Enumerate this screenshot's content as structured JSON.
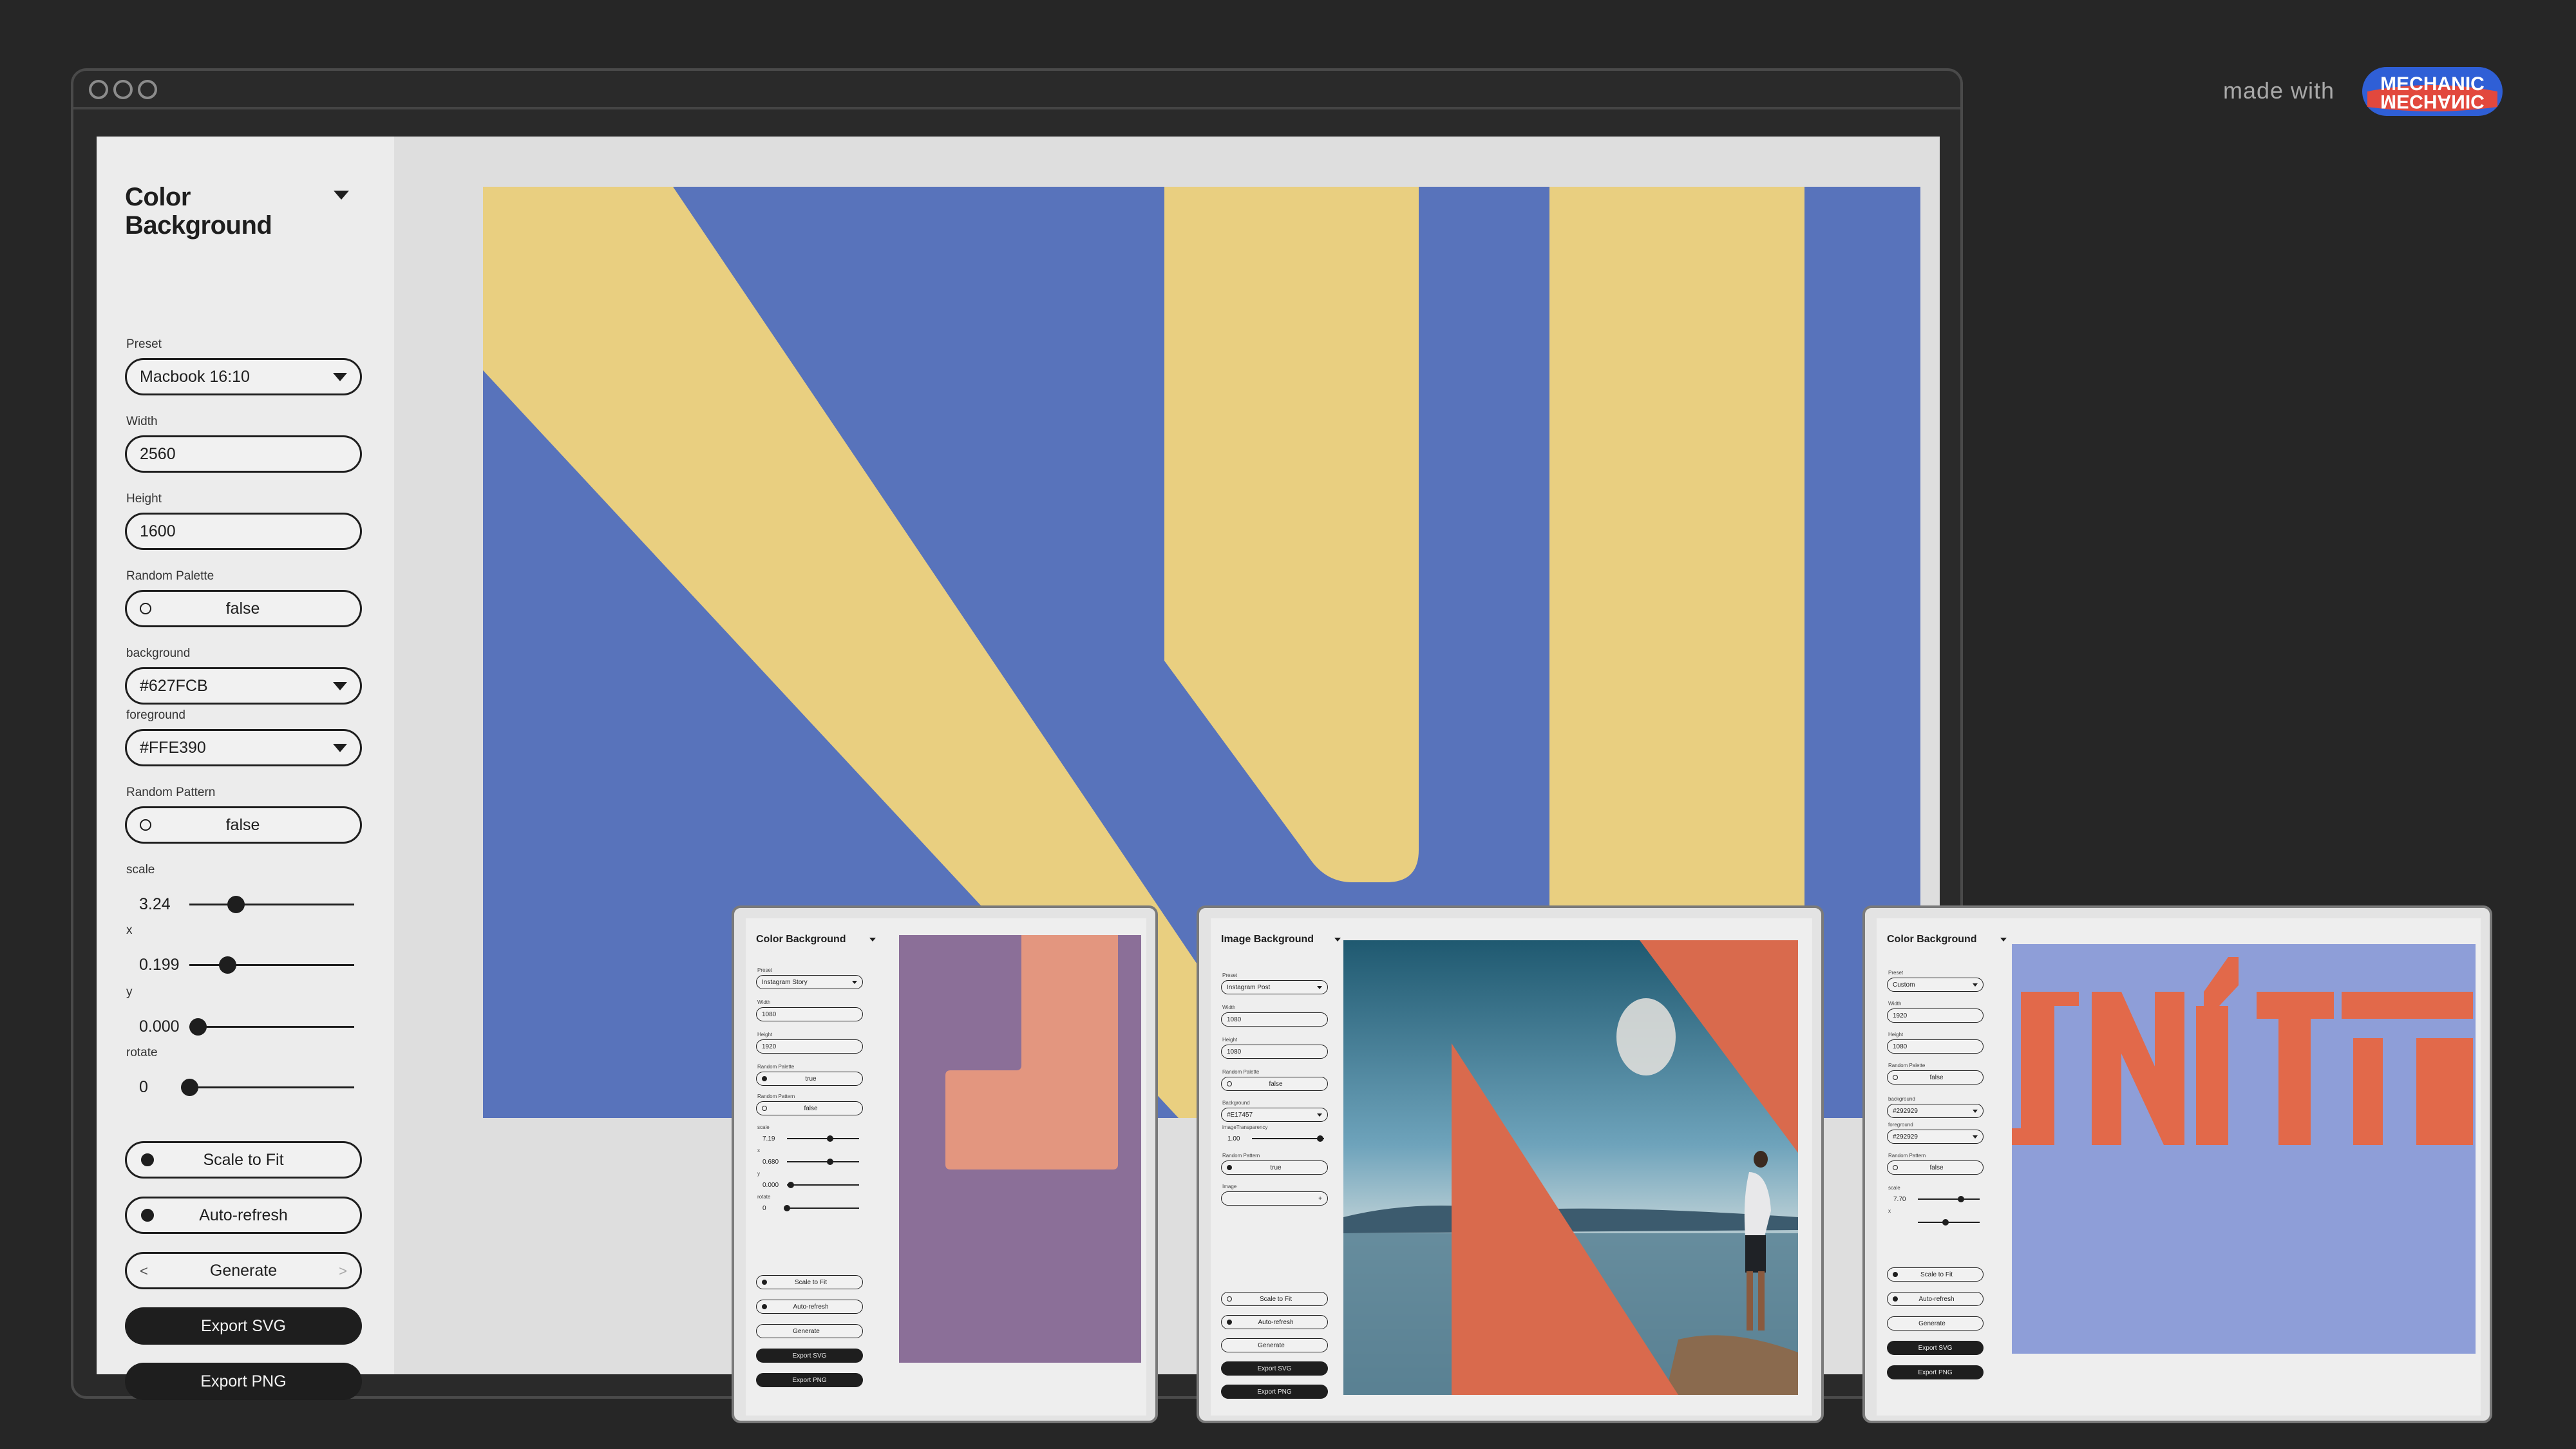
{
  "main": {
    "panel_title": "Color Background",
    "labels": {
      "preset": "Preset",
      "width": "Width",
      "height": "Height",
      "random_palette": "Random Palette",
      "background": "background",
      "foreground": "foreground",
      "random_pattern": "Random Pattern",
      "scale": "scale",
      "x": "x",
      "y": "y",
      "rotate": "rotate"
    },
    "preset_value": "Macbook 16:10",
    "width_value": "2560",
    "height_value": "1600",
    "random_palette_value": "false",
    "background_value": "#627FCB",
    "foreground_value": "#FFE390",
    "random_pattern_value": "false",
    "scale": {
      "value": "3.24",
      "fraction": 0.28
    },
    "x": {
      "value": "0.199",
      "fraction": 0.23
    },
    "y": {
      "value": "0.000",
      "fraction": 0.05
    },
    "rotate": {
      "value": "0",
      "fraction": 0.0
    },
    "buttons": {
      "scale_to_fit": "Scale to Fit",
      "auto_refresh": "Auto-refresh",
      "generate": "Generate",
      "generate_prev": "<",
      "generate_next": ">",
      "export_svg": "Export SVG",
      "export_png": "Export PNG"
    },
    "canvas_colors": {
      "background": "#5873bb",
      "foreground": "#e9cf80"
    }
  },
  "brand": {
    "made_with": "made with",
    "logo_text": "MECHANIC"
  },
  "mini1": {
    "title": "Color Background",
    "labels": [
      "Preset",
      "Width",
      "Height",
      "Random Palette",
      "Random Pattern",
      "scale",
      "x",
      "y",
      "rotate"
    ],
    "preset": "Instagram Story",
    "width": "1080",
    "height": "1920",
    "random_palette": "true",
    "random_pattern": "false",
    "scale": {
      "value": "7.19",
      "fraction": 0.6
    },
    "x": {
      "value": "0.680",
      "fraction": 0.6
    },
    "y": {
      "value": "0.000",
      "fraction": 0.05
    },
    "rotate": {
      "value": "0",
      "fraction": 0.0
    },
    "scale_to_fit": "Scale to Fit",
    "auto_refresh": "Auto-refresh",
    "generate": "Generate",
    "export_svg": "Export SVG",
    "export_png": "Export PNG",
    "colors": {
      "background": "#8b6f98",
      "foreground": "#e3967f"
    }
  },
  "mini2": {
    "title": "Image Background",
    "labels": [
      "Preset",
      "Width",
      "Height",
      "Random Palette",
      "Background",
      "imageTransparency",
      "Random Pattern",
      "Image"
    ],
    "preset": "Instagram Post",
    "width": "1080",
    "height": "1080",
    "random_palette": "false",
    "background": "#E17457",
    "transparency": {
      "value": "1.00",
      "fraction": 0.95
    },
    "random_pattern": "true",
    "image_plus": "+",
    "scale_to_fit": "Scale to Fit",
    "auto_refresh": "Auto-refresh",
    "generate": "Generate",
    "export_svg": "Export SVG",
    "export_png": "Export PNG",
    "colors": {
      "shape": "#d96a4d"
    }
  },
  "mini3": {
    "title": "Color Background",
    "labels": [
      "Preset",
      "Width",
      "Height",
      "Random Palette",
      "background",
      "foreground",
      "Random Pattern",
      "scale",
      "x"
    ],
    "preset": "Custom",
    "width": "1920",
    "height": "1080",
    "random_palette": "false",
    "background": "#292929",
    "foreground": "#292929",
    "random_pattern": "false",
    "scale": {
      "value": "7.70",
      "fraction": 0.7
    },
    "x": {
      "value": "",
      "fraction": 0.45
    },
    "scale_to_fit": "Scale to Fit",
    "auto_refresh": "Auto-refresh",
    "generate": "Generate",
    "export_svg": "Export SVG",
    "export_png": "Export PNG",
    "colors": {
      "background": "#8e9ed8",
      "foreground": "#e2694a"
    }
  }
}
